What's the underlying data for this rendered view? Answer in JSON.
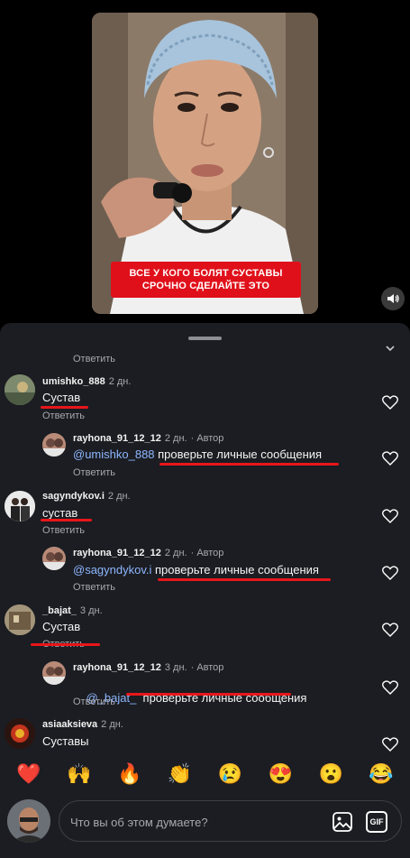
{
  "video": {
    "caption": "ВСЕ У КОГО БОЛЯТ СУСТАВЫ\nСРОЧНО СДЕЛАЙТЕ ЭТО",
    "sound_icon": "speaker-icon"
  },
  "comments": {
    "top_reply_label": "Ответить",
    "items": [
      {
        "user": "umishko_888",
        "time": "2 дн.",
        "text": "Сустав",
        "reply": "Ответить"
      },
      {
        "user": "rayhona_91_12_12",
        "time": "2 дн.",
        "badge": "Автор",
        "mention": "@umishko_888",
        "text": " проверьте личные сообщения",
        "reply": "Ответить"
      },
      {
        "user": "sagyndykov.i",
        "time": "2 дн.",
        "text": "сустав",
        "reply": "Ответить"
      },
      {
        "user": "rayhona_91_12_12",
        "time": "2 дн.",
        "badge": "Автор",
        "mention": "@sagyndykov.i",
        "text": " проверьте личные сообщения",
        "reply": "Ответить"
      },
      {
        "user": "_bajat_",
        "time": "3 дн.",
        "text": "Сустав",
        "reply": "Ответить"
      },
      {
        "user": "rayhona_91_12_12",
        "time": "3 дн.",
        "badge": "Автор",
        "mention": "@_bajat_",
        "text": "  проверьте личные сообщения",
        "reply": "Ответить"
      },
      {
        "user": "asiaaksieva",
        "time": "2 дн.",
        "text": "Суставы"
      }
    ]
  },
  "emoji_bar": [
    "❤️",
    "🙌",
    "🔥",
    "👏",
    "😢",
    "😍",
    "😮",
    "😂"
  ],
  "input": {
    "placeholder": "Что вы об этом думаете?",
    "gif_label": "GIF"
  },
  "colors": {
    "sheet_bg": "#1b1d22",
    "mention": "#8eb6ff",
    "underline_red": "#e8161b",
    "caption_red": "#e0101a"
  }
}
